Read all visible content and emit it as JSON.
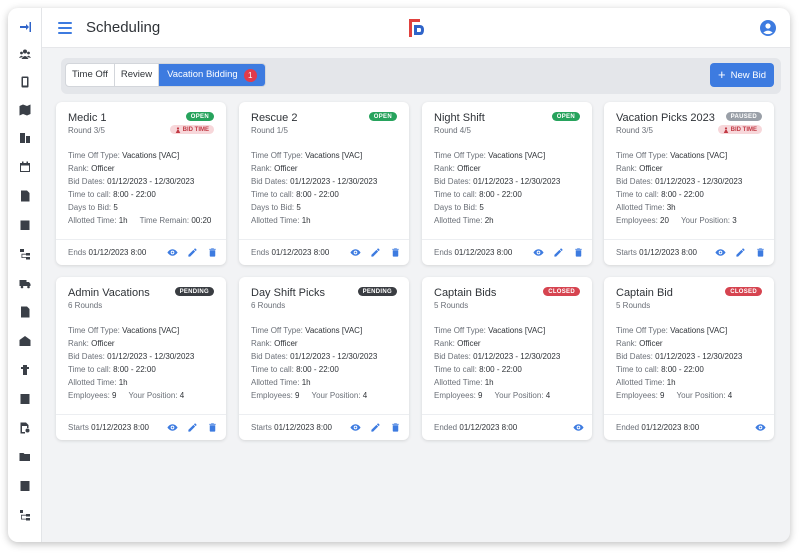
{
  "header": {
    "title": "Scheduling"
  },
  "tabs": [
    {
      "label": "Time Off"
    },
    {
      "label": "Review"
    },
    {
      "label": "Vacation Bidding",
      "badge": "1"
    }
  ],
  "new_bid_label": "New Bid",
  "icons": {
    "sidebar": [
      "collapse-sidebar-icon",
      "people-icon",
      "phone-icon",
      "map-icon",
      "building-list-icon",
      "calendar-icon",
      "document-icon",
      "checklist-icon",
      "org-chart-icon",
      "truck-icon",
      "file-dollar-icon",
      "fire-station-icon",
      "hydrant-icon",
      "book-icon",
      "search-document-icon",
      "folder-settings-icon",
      "form-settings-icon",
      "tree-icon"
    ],
    "card_actions": [
      "view-icon",
      "edit-icon",
      "delete-icon"
    ]
  },
  "colors": {
    "accent": "#3d7be0",
    "open": "#27a35d",
    "paused": "#9aa0a8",
    "pending": "#3a3d42",
    "closed": "#d64450"
  },
  "cards": [
    {
      "title": "Medic 1",
      "subtitle": "Round 3/5",
      "status": "OPEN",
      "bid_time": "BID TIME",
      "rows": [
        [
          [
            "Time Off Type:",
            "Vacations [VAC]"
          ]
        ],
        [
          [
            "Rank:",
            "Officer"
          ]
        ],
        [
          [
            "Bid Dates:",
            "01/12/2023 - 12/30/2023"
          ]
        ],
        [
          [
            "Time to call:",
            "8:00 - 22:00"
          ]
        ],
        [
          [
            "Days to Bid:",
            "5"
          ]
        ],
        [
          [
            "Allotted Time:",
            "1h"
          ],
          [
            "Time Remain:",
            "00:20"
          ]
        ]
      ],
      "footer_label": "Ends",
      "footer_value": "01/12/2023 8:00",
      "actions": [
        "view",
        "edit",
        "delete"
      ]
    },
    {
      "title": "Rescue 2",
      "subtitle": "Round 1/5",
      "status": "OPEN",
      "bid_time": "",
      "rows": [
        [
          [
            "Time Off Type:",
            "Vacations [VAC]"
          ]
        ],
        [
          [
            "Rank:",
            "Officer"
          ]
        ],
        [
          [
            "Bid Dates:",
            "01/12/2023 - 12/30/2023"
          ]
        ],
        [
          [
            "Time to call:",
            "8:00 - 22:00"
          ]
        ],
        [
          [
            "Days to Bid:",
            "5"
          ]
        ],
        [
          [
            "Allotted Time:",
            "1h"
          ]
        ]
      ],
      "footer_label": "Ends",
      "footer_value": "01/12/2023 8:00",
      "actions": [
        "view",
        "edit",
        "delete"
      ]
    },
    {
      "title": "Night Shift",
      "subtitle": "Round 4/5",
      "status": "OPEN",
      "bid_time": "",
      "rows": [
        [
          [
            "Time Off Type:",
            "Vacations [VAC]"
          ]
        ],
        [
          [
            "Rank:",
            "Officer"
          ]
        ],
        [
          [
            "Bid Dates:",
            "01/12/2023 - 12/30/2023"
          ]
        ],
        [
          [
            "Time to call:",
            "8:00 - 22:00"
          ]
        ],
        [
          [
            "Days to Bid:",
            "5"
          ]
        ],
        [
          [
            "Allotted Time:",
            "2h"
          ]
        ]
      ],
      "footer_label": "Ends",
      "footer_value": "01/12/2023 8:00",
      "actions": [
        "view",
        "edit",
        "delete"
      ]
    },
    {
      "title": "Vacation Picks 2023",
      "subtitle": "Round 3/5",
      "status": "PAUSED",
      "bid_time": "BID TIME",
      "rows": [
        [
          [
            "Time Off Type:",
            "Vacations [VAC]"
          ]
        ],
        [
          [
            "Rank:",
            "Officer"
          ]
        ],
        [
          [
            "Bid Dates:",
            "01/12/2023 - 12/30/2023"
          ]
        ],
        [
          [
            "Time to call:",
            "8:00 - 22:00"
          ]
        ],
        [
          [
            "Allotted Time:",
            "3h"
          ]
        ],
        [
          [
            "Employees:",
            "20"
          ],
          [
            "Your Position:",
            "3"
          ]
        ]
      ],
      "footer_label": "Starts",
      "footer_value": "01/12/2023 8:00",
      "actions": [
        "view",
        "edit",
        "delete"
      ]
    },
    {
      "title": "Admin Vacations",
      "subtitle": "6 Rounds",
      "status": "PENDING",
      "bid_time": "",
      "rows": [
        [
          [
            "Time Off Type:",
            "Vacations [VAC]"
          ]
        ],
        [
          [
            "Rank:",
            "Officer"
          ]
        ],
        [
          [
            "Bid Dates:",
            "01/12/2023 - 12/30/2023"
          ]
        ],
        [
          [
            "Time to call:",
            "8:00 - 22:00"
          ]
        ],
        [
          [
            "Allotted Time:",
            "1h"
          ]
        ],
        [
          [
            "Employees:",
            "9"
          ],
          [
            "Your Position:",
            "4"
          ]
        ]
      ],
      "footer_label": "Starts",
      "footer_value": "01/12/2023 8:00",
      "actions": [
        "view",
        "edit",
        "delete"
      ]
    },
    {
      "title": "Day Shift Picks",
      "subtitle": "6 Rounds",
      "status": "PENDING",
      "bid_time": "",
      "rows": [
        [
          [
            "Time Off Type:",
            "Vacations [VAC]"
          ]
        ],
        [
          [
            "Rank:",
            "Officer"
          ]
        ],
        [
          [
            "Bid Dates:",
            "01/12/2023 - 12/30/2023"
          ]
        ],
        [
          [
            "Time to call:",
            "8:00 - 22:00"
          ]
        ],
        [
          [
            "Allotted Time:",
            "1h"
          ]
        ],
        [
          [
            "Employees:",
            "9"
          ],
          [
            "Your Position:",
            "4"
          ]
        ]
      ],
      "footer_label": "Starts",
      "footer_value": "01/12/2023 8:00",
      "actions": [
        "view",
        "edit",
        "delete"
      ]
    },
    {
      "title": "Captain Bids",
      "subtitle": "5 Rounds",
      "status": "CLOSED",
      "bid_time": "",
      "rows": [
        [
          [
            "Time Off Type:",
            "Vacations [VAC]"
          ]
        ],
        [
          [
            "Rank:",
            "Officer"
          ]
        ],
        [
          [
            "Bid Dates:",
            "01/12/2023 - 12/30/2023"
          ]
        ],
        [
          [
            "Time to call:",
            "8:00 - 22:00"
          ]
        ],
        [
          [
            "Allotted Time:",
            "1h"
          ]
        ],
        [
          [
            "Employees:",
            "9"
          ],
          [
            "Your Position:",
            "4"
          ]
        ]
      ],
      "footer_label": "Ended",
      "footer_value": "01/12/2023 8:00",
      "actions": [
        "view"
      ]
    },
    {
      "title": "Captain Bid",
      "subtitle": "5 Rounds",
      "status": "CLOSED",
      "bid_time": "",
      "rows": [
        [
          [
            "Time Off Type:",
            "Vacations [VAC]"
          ]
        ],
        [
          [
            "Rank:",
            "Officer"
          ]
        ],
        [
          [
            "Bid Dates:",
            "01/12/2023 - 12/30/2023"
          ]
        ],
        [
          [
            "Time to call:",
            "8:00 - 22:00"
          ]
        ],
        [
          [
            "Allotted Time:",
            "1h"
          ]
        ],
        [
          [
            "Employees:",
            "9"
          ],
          [
            "Your Position:",
            "4"
          ]
        ]
      ],
      "footer_label": "Ended",
      "footer_value": "01/12/2023 8:00",
      "actions": [
        "view"
      ]
    }
  ]
}
